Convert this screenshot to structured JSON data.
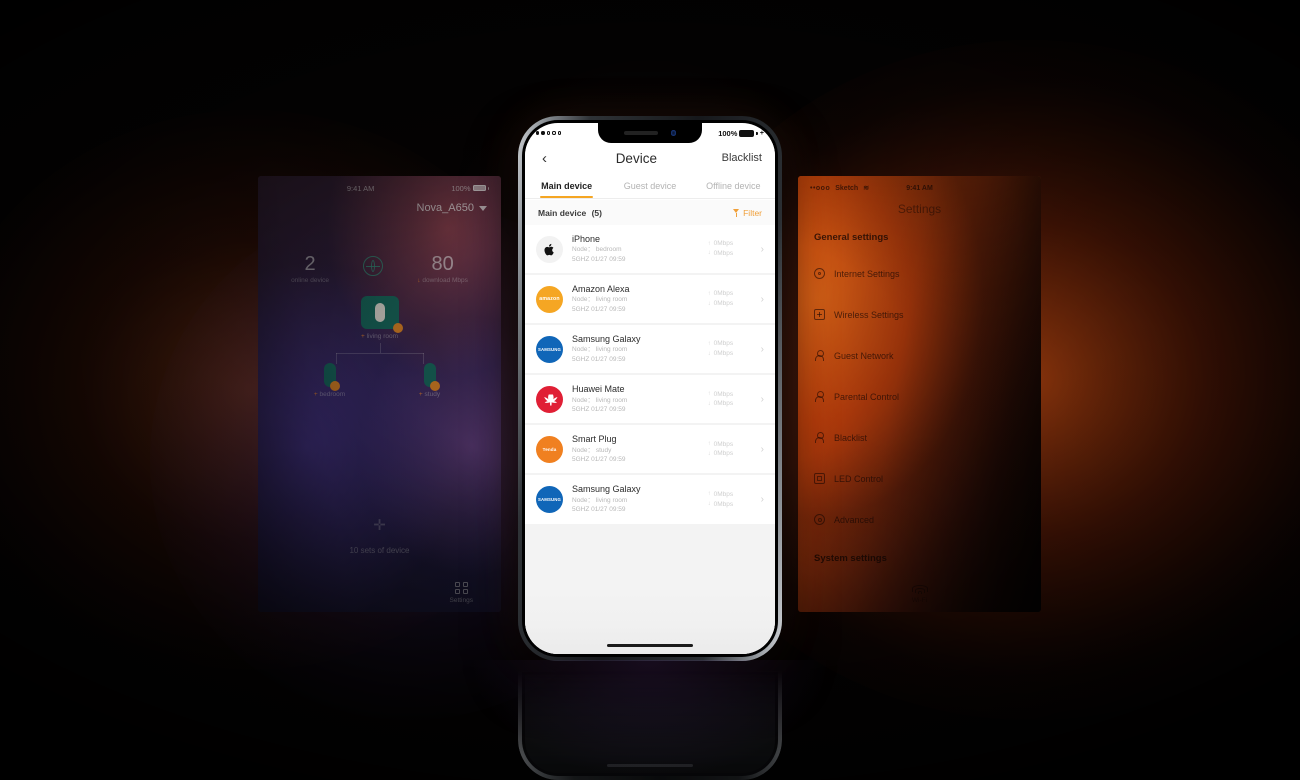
{
  "main_phone": {
    "status_bar": {
      "signal": "••ooo",
      "battery": "100%"
    },
    "navbar": {
      "back_icon": "chevron-left-icon",
      "title": "Device",
      "action": "Blacklist"
    },
    "tabs": [
      {
        "label": "Main device",
        "active": true
      },
      {
        "label": "Guest device",
        "active": false
      },
      {
        "label": "Offline device",
        "active": false
      }
    ],
    "section": {
      "title": "Main device",
      "count": "(5)",
      "filter_label": "Filter",
      "filter_icon": "funnel-icon",
      "filter_color": "#f0a03a"
    },
    "devices": [
      {
        "name": "iPhone",
        "node_label": "Node：",
        "node": "bedroom",
        "band": "5GHZ",
        "timestamp": "01/27 09:59",
        "up": "0Mbps",
        "down": "0Mbps",
        "brand": "apple",
        "icon_bg": "#f2f2f2",
        "icon_text": ""
      },
      {
        "name": "Amazon Alexa",
        "node_label": "Node：",
        "node": "living room",
        "band": "5GHZ",
        "timestamp": "01/27 09:59",
        "up": "0Mbps",
        "down": "0Mbps",
        "brand": "amazon",
        "icon_bg": "#f5a623",
        "icon_text": "amazon"
      },
      {
        "name": "Samsung Galaxy",
        "node_label": "Node：",
        "node": "living room",
        "band": "5GHZ",
        "timestamp": "01/27 09:59",
        "up": "0Mbps",
        "down": "0Mbps",
        "brand": "samsung",
        "icon_bg": "#1066b8",
        "icon_text": "SAMSUNG"
      },
      {
        "name": "Huawei Mate",
        "node_label": "Node：",
        "node": "living room",
        "band": "5GHZ",
        "timestamp": "01/27 09:59",
        "up": "0Mbps",
        "down": "0Mbps",
        "brand": "huawei",
        "icon_bg": "#e01f35",
        "icon_text": ""
      },
      {
        "name": "Smart Plug",
        "node_label": "Node：",
        "node": "study",
        "band": "5GHZ",
        "timestamp": "01/27 09:59",
        "up": "0Mbps",
        "down": "0Mbps",
        "brand": "tenda",
        "icon_bg": "#f08020",
        "icon_text": "Tenda"
      },
      {
        "name": "Samsung Galaxy",
        "node_label": "Node：",
        "node": "living room",
        "band": "5GHZ",
        "timestamp": "01/27 09:59",
        "up": "0Mbps",
        "down": "0Mbps",
        "brand": "samsung",
        "icon_bg": "#1066b8",
        "icon_text": "SAMSUNG"
      }
    ]
  },
  "left_phone": {
    "status_bar": {
      "time": "9:41 AM",
      "battery": "100%"
    },
    "ssid": "Nova_A650",
    "stats": [
      {
        "value": "2",
        "label": "online device"
      },
      {
        "value": "",
        "label": "",
        "icon": "globe-icon"
      },
      {
        "value": "80",
        "label": "download Mbps"
      }
    ],
    "topology": {
      "main_node": "living room",
      "sub_nodes": [
        "bedroom",
        "study"
      ]
    },
    "add_icon": "plus-icon",
    "device_count_label": "10 sets of device",
    "tabbar": {
      "icon": "grid-icon",
      "label": "Settings"
    }
  },
  "right_phone": {
    "status_bar": {
      "signal": "••ooo",
      "carrier": "Sketch",
      "wifi_icon": "wifi-icon",
      "time": "9:41 AM"
    },
    "title": "Settings",
    "groups": [
      {
        "header": "General settings",
        "items": [
          {
            "label": "Internet Settings",
            "icon": "gear-icon"
          },
          {
            "label": "Wireless Settings",
            "icon": "wifi-settings-icon"
          },
          {
            "label": "Guest Network",
            "icon": "user-icon"
          },
          {
            "label": "Parental Control",
            "icon": "user-icon"
          },
          {
            "label": "Blacklist",
            "icon": "user-icon"
          },
          {
            "label": "LED Control",
            "icon": "home-icon"
          },
          {
            "label": "Advanced",
            "icon": "circle-icon"
          }
        ]
      },
      {
        "header": "System settings",
        "items": []
      }
    ],
    "tabbar": {
      "icon": "wifi-icon",
      "label": "Wi-Fi"
    }
  },
  "theme": {
    "accent": "#f5a623",
    "filter_orange": "#f0a03a",
    "background": "#050303"
  }
}
